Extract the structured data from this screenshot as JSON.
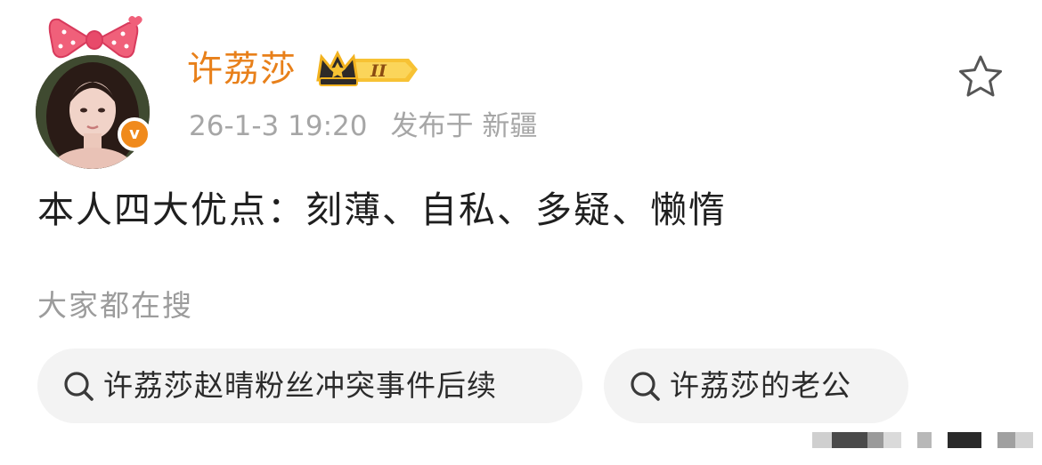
{
  "post": {
    "author": {
      "name": "许荔莎",
      "vip_level": "II",
      "verified_mark": "v"
    },
    "meta": {
      "time": "26-1-3 19:20",
      "location": "发布于 新疆"
    },
    "content": "本人四大优点：刻薄、自私、多疑、懒惰"
  },
  "search": {
    "label": "大家都在搜",
    "chips": [
      {
        "icon": "search-icon",
        "text": "许荔莎赵晴粉丝冲突事件后续"
      },
      {
        "icon": "search-icon",
        "text": "许荔莎的老公"
      }
    ]
  },
  "icons": {
    "favorite": "star-outline-icon",
    "avatar_decoration": "pink-bow-icon",
    "vip": "crown-badge-icon"
  },
  "colors": {
    "username": "#e8801a",
    "verified": "#f08a1c",
    "meta_text": "#a6a6a6",
    "chip_bg": "#f3f3f3",
    "bow": "#f0607a"
  }
}
